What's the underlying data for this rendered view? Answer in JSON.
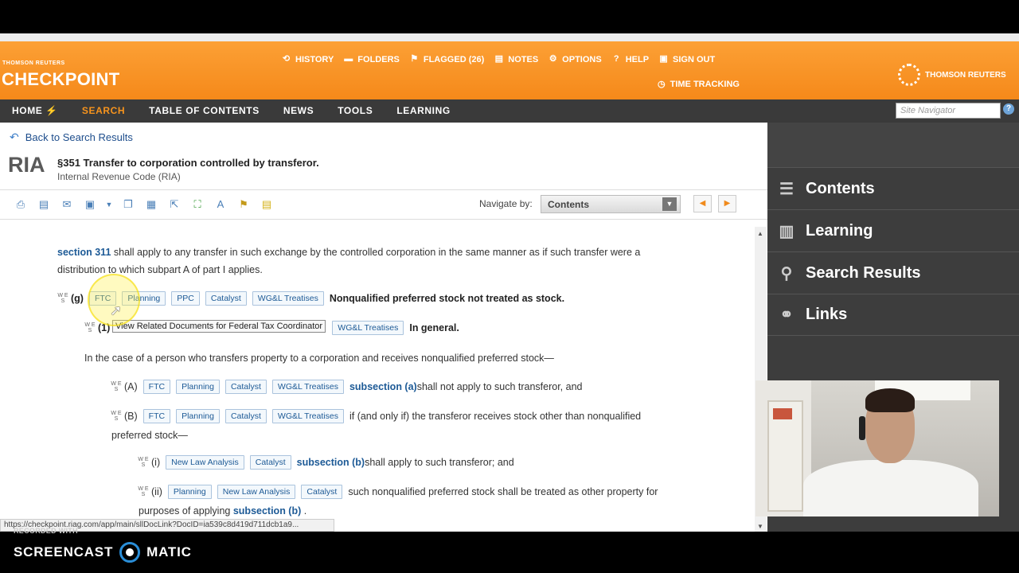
{
  "header": {
    "brand_small": "THOMSON REUTERS",
    "brand_big": "CHECKPOINT",
    "links": [
      {
        "label": "HISTORY",
        "icon": "history-icon"
      },
      {
        "label": "FOLDERS",
        "icon": "folder-icon"
      },
      {
        "label": "FLAGGED (26)",
        "icon": "flag-icon"
      },
      {
        "label": "NOTES",
        "icon": "note-icon"
      },
      {
        "label": "OPTIONS",
        "icon": "gear-icon"
      },
      {
        "label": "HELP",
        "icon": "help-icon"
      },
      {
        "label": "SIGN OUT",
        "icon": "sign-out-icon"
      }
    ],
    "time_tracking": "TIME TRACKING",
    "tr_logo": "THOMSON REUTERS"
  },
  "nav": {
    "items": [
      "HOME",
      "SEARCH",
      "TABLE OF CONTENTS",
      "NEWS",
      "TOOLS",
      "LEARNING"
    ],
    "active": "SEARCH",
    "site_navigator_placeholder": "Site Navigator"
  },
  "doc": {
    "back_label": "Back to Search Results",
    "logo": "RIA",
    "title": "§351 Transfer to corporation controlled by transferor.",
    "subtitle": "Internal Revenue Code (RIA)",
    "navigate_by_label": "Navigate by:",
    "navigate_by_value": "Contents"
  },
  "content": {
    "p1_link": "section 311",
    "p1_text": " shall apply to any transfer in such exchange by the controlled corporation in the same manner as if such transfer were a",
    "p1_text2": "distribution to which subpart A of part I applies.",
    "g_label": "(g)",
    "g_buttons": [
      "FTC",
      "Planning",
      "PPC",
      "Catalyst",
      "WG&L Treatises"
    ],
    "g_heading": "Nonqualified preferred stock not treated as stock.",
    "g1_label": "(1)",
    "g1_button": "WG&L Treatises",
    "g1_heading": "In general.",
    "tooltip": "View Related Documents for Federal Tax Coordinator",
    "p2_text": "In the case of a person who transfers property to a corporation and receives nonqualified preferred stock—",
    "a_label": "(A)",
    "a_buttons": [
      "FTC",
      "Planning",
      "Catalyst",
      "WG&L Treatises"
    ],
    "a_link": "subsection (a)",
    "a_text": " shall not apply to such transferor, and",
    "b_label": "(B)",
    "b_buttons": [
      "FTC",
      "Planning",
      "Catalyst",
      "WG&L Treatises"
    ],
    "b_text": "if (and only if) the transferor receives stock other than nonqualified",
    "b_text2": "preferred stock—",
    "i_label": "(i)",
    "i_buttons": [
      "New Law Analysis",
      "Catalyst"
    ],
    "i_link": "subsection (b)",
    "i_text": " shall apply to such transferor; and",
    "ii_label": "(ii)",
    "ii_buttons": [
      "Planning",
      "New Law Analysis",
      "Catalyst"
    ],
    "ii_text": "such nonqualified preferred stock shall be treated as other property for",
    "ii_text2": "purposes of applying ",
    "ii_link": "subsection (b)",
    "ii_end": " ."
  },
  "sidepanel": {
    "items": [
      {
        "label": "Contents",
        "icon": "list-icon"
      },
      {
        "label": "Learning",
        "icon": "books-icon"
      },
      {
        "label": "Search Results",
        "icon": "search-icon"
      },
      {
        "label": "Links",
        "icon": "link-icon"
      }
    ]
  },
  "statusbar": "https://checkpoint.riag.com/app/main/sllDocLink?DocID=ia539c8d419d711dcb1a9...",
  "footer": {
    "recorded": "RECORDED WITH",
    "screencast": "SCREENCAST",
    "matic": "MATIC"
  }
}
